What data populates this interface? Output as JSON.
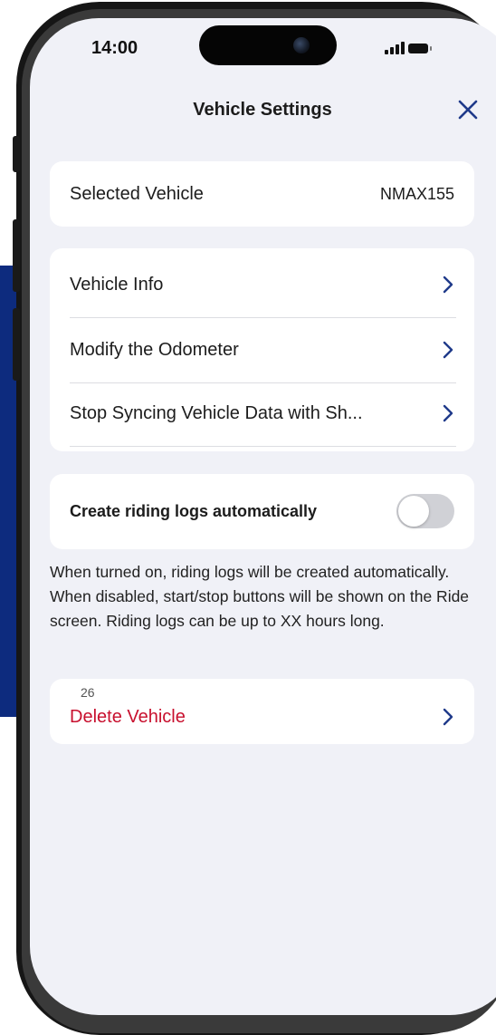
{
  "status_bar": {
    "time": "14:00"
  },
  "header": {
    "title": "Vehicle Settings"
  },
  "selected_vehicle": {
    "label": "Selected Vehicle",
    "value": "NMAX155"
  },
  "menu_items": [
    {
      "label": "Vehicle Info"
    },
    {
      "label": "Modify the Odometer"
    },
    {
      "label": "Stop Syncing Vehicle Data with Sh..."
    }
  ],
  "auto_log": {
    "label": "Create riding logs automatically",
    "enabled": false,
    "description": "When turned on, riding logs will be created automatically. When disabled, start/stop buttons will be shown on the Ride screen. Riding logs can be up to XX hours long."
  },
  "delete": {
    "small_text": "26",
    "label": "Delete Vehicle",
    "color": "#c8102e"
  },
  "colors": {
    "accent": "#1f3a8a",
    "background": "#f0f1f7",
    "side_band": "#0d2b7e"
  },
  "icons": {
    "close": "close-icon",
    "chevron": "chevron-right-icon"
  }
}
